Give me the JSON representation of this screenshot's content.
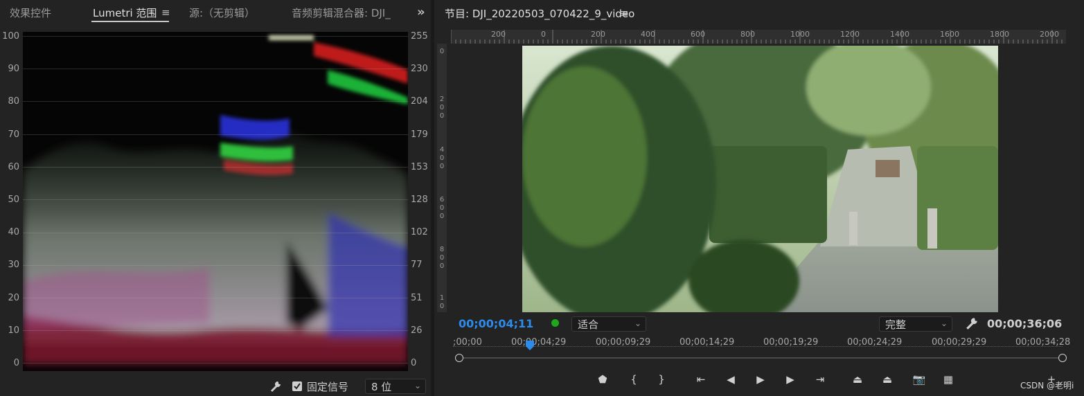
{
  "left_panel": {
    "tabs": [
      {
        "label": "效果控件",
        "active": false
      },
      {
        "label": "Lumetri 范围",
        "active": true
      },
      {
        "label": "源:（无剪辑）",
        "active": false
      },
      {
        "label": "音频剪辑混合器: DJI_",
        "active": false
      }
    ],
    "menu_icon": "≡",
    "overflow_icon": "»",
    "scope": {
      "type": "waveform",
      "left_scale": [
        "100",
        "90",
        "80",
        "70",
        "60",
        "50",
        "40",
        "30",
        "20",
        "10",
        "0"
      ],
      "right_scale": [
        "255",
        "230",
        "204",
        "179",
        "153",
        "128",
        "102",
        "77",
        "51",
        "26",
        "0"
      ]
    },
    "footer": {
      "wrench_icon": "wrench-icon",
      "clamp_signal_label": "固定信号",
      "clamp_signal_checked": true,
      "bit_depth": "8 位"
    }
  },
  "right_panel": {
    "title": "节目: DJI_20220503_070422_9_video",
    "menu_icon": "≡",
    "ruler_top": [
      "200",
      "0",
      "200",
      "400",
      "600",
      "800",
      "1000",
      "1200",
      "1400",
      "1600",
      "1800",
      "2000"
    ],
    "ruler_left": [
      "0",
      "200",
      "400",
      "600",
      "800",
      "10"
    ],
    "current_time": "00;00;04;11",
    "zoom": "适合",
    "quality": "完整",
    "duration": "00;00;36;06",
    "timeline_labels": [
      ";00;00",
      "00;00;04;29",
      "00;00;09;29",
      "00;00;14;29",
      "00;00;19;29",
      "00;00;24;29",
      "00;00;29;29",
      "00;00;34;28"
    ],
    "playhead_position": 0.117,
    "controls": [
      {
        "name": "add-marker-button",
        "glyph": "⬟"
      },
      {
        "name": "mark-in-button",
        "glyph": "{"
      },
      {
        "name": "mark-out-button",
        "glyph": "}"
      },
      {
        "name": "go-to-in-button",
        "glyph": "⇤"
      },
      {
        "name": "step-back-button",
        "glyph": "◀"
      },
      {
        "name": "play-button",
        "glyph": "▶"
      },
      {
        "name": "step-forward-button",
        "glyph": "▶"
      },
      {
        "name": "go-to-out-button",
        "glyph": "⇥"
      },
      {
        "name": "lift-button",
        "glyph": "⏏"
      },
      {
        "name": "extract-button",
        "glyph": "⏏"
      },
      {
        "name": "export-frame-button",
        "glyph": "📷"
      },
      {
        "name": "comparison-view-button",
        "glyph": "▦"
      },
      {
        "name": "button-editor-button",
        "glyph": "+"
      }
    ],
    "watermark": "CSDN @老明i"
  }
}
